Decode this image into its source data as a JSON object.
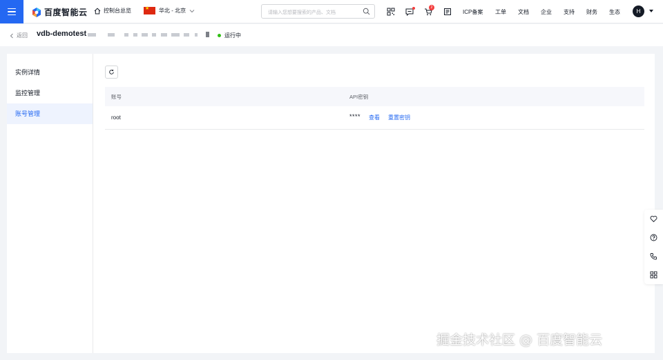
{
  "topbar": {
    "brand": "百度智能云",
    "console_overview": "控制台总览",
    "region": "华北 - 北京",
    "search_placeholder": "请输入您想要搜索的产品、文档",
    "cart_count": "2",
    "nav": [
      "ICP备案",
      "工单",
      "文档",
      "企业",
      "支持",
      "财务",
      "生态"
    ],
    "avatar_initial": "H"
  },
  "header": {
    "back_label": "返回",
    "instance_name": "vdb-demotest",
    "status": "运行中",
    "status_color": "#30bf13"
  },
  "sidebar": {
    "items": [
      {
        "label": "实例详情",
        "active": false
      },
      {
        "label": "监控管理",
        "active": false
      },
      {
        "label": "账号管理",
        "active": true
      }
    ]
  },
  "table": {
    "columns": [
      "账号",
      "API密钥"
    ],
    "rows": [
      {
        "account": "root",
        "api_key": "****",
        "view_label": "查看",
        "reset_label": "重置密钥"
      }
    ]
  },
  "watermark": "掘金技术社区 @ 百度智能云",
  "colors": {
    "accent": "#2468f2",
    "active_bg": "#eef3fe",
    "badge": "#f33e3e"
  }
}
